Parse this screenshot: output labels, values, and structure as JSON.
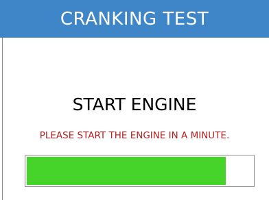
{
  "header": {
    "title": "CRANKING TEST"
  },
  "main": {
    "message": "START ENGINE",
    "instruction": "PLEASE START THE ENGINE IN A MINUTE."
  },
  "progress": {
    "fraction": 0.88
  },
  "colors": {
    "header_bg": "#3f86c9",
    "header_text": "#ffffff",
    "message_text": "#000000",
    "instruction_text": "#b21f1f",
    "progress_fill": "#46d32a",
    "progress_border": "#8f8f8f"
  }
}
